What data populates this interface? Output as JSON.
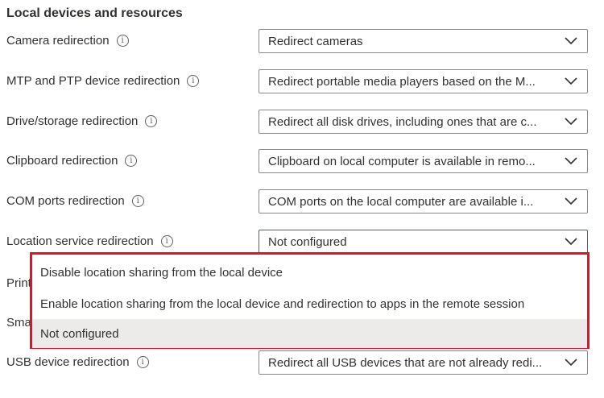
{
  "section": {
    "title": "Local devices and resources"
  },
  "rows": [
    {
      "label": "Camera redirection",
      "value": "Redirect cameras"
    },
    {
      "label": "MTP and PTP device redirection",
      "value": "Redirect portable media players based on the M..."
    },
    {
      "label": "Drive/storage redirection",
      "value": "Redirect all disk drives, including ones that are c..."
    },
    {
      "label": "Clipboard redirection",
      "value": "Clipboard on local computer is available in remo..."
    },
    {
      "label": "COM ports redirection",
      "value": "COM ports on the local computer are available i..."
    },
    {
      "label": "Location service redirection",
      "value": "Not configured"
    },
    {
      "label": "Print",
      "value": ""
    },
    {
      "label": "Sma",
      "value": ""
    },
    {
      "label": "USB device redirection",
      "value": "Redirect all USB devices that are not already redi..."
    }
  ],
  "dropdown": {
    "options": [
      {
        "label": "Disable location sharing from the local device"
      },
      {
        "label": "Enable location sharing from the local device and redirection to apps in the remote session"
      },
      {
        "label": "Not configured"
      }
    ],
    "selected_option": "Not configured"
  },
  "icons": {
    "info": "info-icon",
    "chevron": "chevron-down-icon"
  },
  "colors": {
    "focus_border": "#0078d4",
    "highlight_box": "#e81123",
    "selected_option_bg": "#edebe9"
  }
}
